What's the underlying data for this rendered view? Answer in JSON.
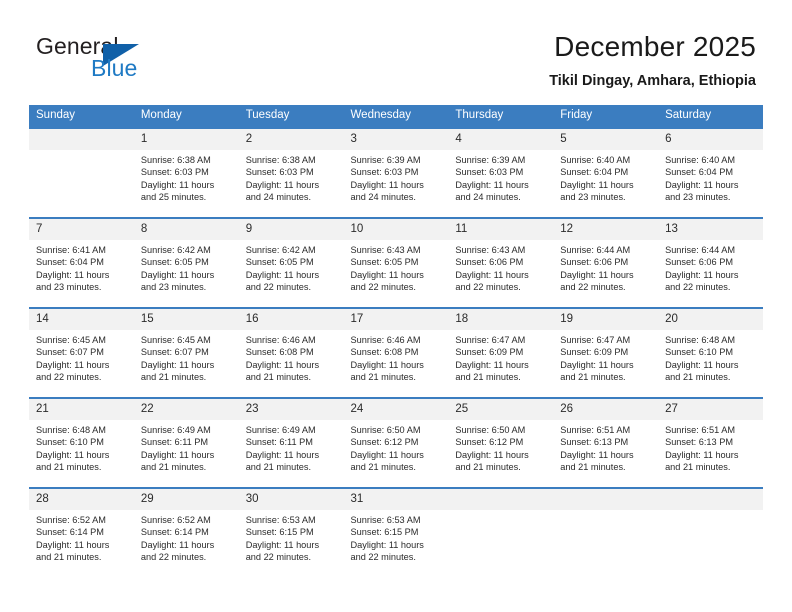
{
  "brand": {
    "name_part1": "General",
    "name_part2": "Blue",
    "accent_color": "#1060a8",
    "blue_text_color": "#1f7ac4"
  },
  "header": {
    "title": "December 2025",
    "subtitle": "Tikil Dingay, Amhara, Ethiopia"
  },
  "calendar": {
    "header_bg": "#3b7dc0",
    "datenum_bg": "#f2f2f2",
    "weekday_headers": [
      "Sunday",
      "Monday",
      "Tuesday",
      "Wednesday",
      "Thursday",
      "Friday",
      "Saturday"
    ],
    "labels": {
      "sunrise": "Sunrise:",
      "sunset": "Sunset:",
      "daylight": "Daylight:"
    },
    "weeks": [
      [
        {
          "day": "",
          "sunrise": "",
          "sunset": "",
          "daylight_line1": "",
          "daylight_line2": ""
        },
        {
          "day": "1",
          "sunrise": "Sunrise: 6:38 AM",
          "sunset": "Sunset: 6:03 PM",
          "daylight_line1": "Daylight: 11 hours",
          "daylight_line2": "and 25 minutes."
        },
        {
          "day": "2",
          "sunrise": "Sunrise: 6:38 AM",
          "sunset": "Sunset: 6:03 PM",
          "daylight_line1": "Daylight: 11 hours",
          "daylight_line2": "and 24 minutes."
        },
        {
          "day": "3",
          "sunrise": "Sunrise: 6:39 AM",
          "sunset": "Sunset: 6:03 PM",
          "daylight_line1": "Daylight: 11 hours",
          "daylight_line2": "and 24 minutes."
        },
        {
          "day": "4",
          "sunrise": "Sunrise: 6:39 AM",
          "sunset": "Sunset: 6:03 PM",
          "daylight_line1": "Daylight: 11 hours",
          "daylight_line2": "and 24 minutes."
        },
        {
          "day": "5",
          "sunrise": "Sunrise: 6:40 AM",
          "sunset": "Sunset: 6:04 PM",
          "daylight_line1": "Daylight: 11 hours",
          "daylight_line2": "and 23 minutes."
        },
        {
          "day": "6",
          "sunrise": "Sunrise: 6:40 AM",
          "sunset": "Sunset: 6:04 PM",
          "daylight_line1": "Daylight: 11 hours",
          "daylight_line2": "and 23 minutes."
        }
      ],
      [
        {
          "day": "7",
          "sunrise": "Sunrise: 6:41 AM",
          "sunset": "Sunset: 6:04 PM",
          "daylight_line1": "Daylight: 11 hours",
          "daylight_line2": "and 23 minutes."
        },
        {
          "day": "8",
          "sunrise": "Sunrise: 6:42 AM",
          "sunset": "Sunset: 6:05 PM",
          "daylight_line1": "Daylight: 11 hours",
          "daylight_line2": "and 23 minutes."
        },
        {
          "day": "9",
          "sunrise": "Sunrise: 6:42 AM",
          "sunset": "Sunset: 6:05 PM",
          "daylight_line1": "Daylight: 11 hours",
          "daylight_line2": "and 22 minutes."
        },
        {
          "day": "10",
          "sunrise": "Sunrise: 6:43 AM",
          "sunset": "Sunset: 6:05 PM",
          "daylight_line1": "Daylight: 11 hours",
          "daylight_line2": "and 22 minutes."
        },
        {
          "day": "11",
          "sunrise": "Sunrise: 6:43 AM",
          "sunset": "Sunset: 6:06 PM",
          "daylight_line1": "Daylight: 11 hours",
          "daylight_line2": "and 22 minutes."
        },
        {
          "day": "12",
          "sunrise": "Sunrise: 6:44 AM",
          "sunset": "Sunset: 6:06 PM",
          "daylight_line1": "Daylight: 11 hours",
          "daylight_line2": "and 22 minutes."
        },
        {
          "day": "13",
          "sunrise": "Sunrise: 6:44 AM",
          "sunset": "Sunset: 6:06 PM",
          "daylight_line1": "Daylight: 11 hours",
          "daylight_line2": "and 22 minutes."
        }
      ],
      [
        {
          "day": "14",
          "sunrise": "Sunrise: 6:45 AM",
          "sunset": "Sunset: 6:07 PM",
          "daylight_line1": "Daylight: 11 hours",
          "daylight_line2": "and 22 minutes."
        },
        {
          "day": "15",
          "sunrise": "Sunrise: 6:45 AM",
          "sunset": "Sunset: 6:07 PM",
          "daylight_line1": "Daylight: 11 hours",
          "daylight_line2": "and 21 minutes."
        },
        {
          "day": "16",
          "sunrise": "Sunrise: 6:46 AM",
          "sunset": "Sunset: 6:08 PM",
          "daylight_line1": "Daylight: 11 hours",
          "daylight_line2": "and 21 minutes."
        },
        {
          "day": "17",
          "sunrise": "Sunrise: 6:46 AM",
          "sunset": "Sunset: 6:08 PM",
          "daylight_line1": "Daylight: 11 hours",
          "daylight_line2": "and 21 minutes."
        },
        {
          "day": "18",
          "sunrise": "Sunrise: 6:47 AM",
          "sunset": "Sunset: 6:09 PM",
          "daylight_line1": "Daylight: 11 hours",
          "daylight_line2": "and 21 minutes."
        },
        {
          "day": "19",
          "sunrise": "Sunrise: 6:47 AM",
          "sunset": "Sunset: 6:09 PM",
          "daylight_line1": "Daylight: 11 hours",
          "daylight_line2": "and 21 minutes."
        },
        {
          "day": "20",
          "sunrise": "Sunrise: 6:48 AM",
          "sunset": "Sunset: 6:10 PM",
          "daylight_line1": "Daylight: 11 hours",
          "daylight_line2": "and 21 minutes."
        }
      ],
      [
        {
          "day": "21",
          "sunrise": "Sunrise: 6:48 AM",
          "sunset": "Sunset: 6:10 PM",
          "daylight_line1": "Daylight: 11 hours",
          "daylight_line2": "and 21 minutes."
        },
        {
          "day": "22",
          "sunrise": "Sunrise: 6:49 AM",
          "sunset": "Sunset: 6:11 PM",
          "daylight_line1": "Daylight: 11 hours",
          "daylight_line2": "and 21 minutes."
        },
        {
          "day": "23",
          "sunrise": "Sunrise: 6:49 AM",
          "sunset": "Sunset: 6:11 PM",
          "daylight_line1": "Daylight: 11 hours",
          "daylight_line2": "and 21 minutes."
        },
        {
          "day": "24",
          "sunrise": "Sunrise: 6:50 AM",
          "sunset": "Sunset: 6:12 PM",
          "daylight_line1": "Daylight: 11 hours",
          "daylight_line2": "and 21 minutes."
        },
        {
          "day": "25",
          "sunrise": "Sunrise: 6:50 AM",
          "sunset": "Sunset: 6:12 PM",
          "daylight_line1": "Daylight: 11 hours",
          "daylight_line2": "and 21 minutes."
        },
        {
          "day": "26",
          "sunrise": "Sunrise: 6:51 AM",
          "sunset": "Sunset: 6:13 PM",
          "daylight_line1": "Daylight: 11 hours",
          "daylight_line2": "and 21 minutes."
        },
        {
          "day": "27",
          "sunrise": "Sunrise: 6:51 AM",
          "sunset": "Sunset: 6:13 PM",
          "daylight_line1": "Daylight: 11 hours",
          "daylight_line2": "and 21 minutes."
        }
      ],
      [
        {
          "day": "28",
          "sunrise": "Sunrise: 6:52 AM",
          "sunset": "Sunset: 6:14 PM",
          "daylight_line1": "Daylight: 11 hours",
          "daylight_line2": "and 21 minutes."
        },
        {
          "day": "29",
          "sunrise": "Sunrise: 6:52 AM",
          "sunset": "Sunset: 6:14 PM",
          "daylight_line1": "Daylight: 11 hours",
          "daylight_line2": "and 22 minutes."
        },
        {
          "day": "30",
          "sunrise": "Sunrise: 6:53 AM",
          "sunset": "Sunset: 6:15 PM",
          "daylight_line1": "Daylight: 11 hours",
          "daylight_line2": "and 22 minutes."
        },
        {
          "day": "31",
          "sunrise": "Sunrise: 6:53 AM",
          "sunset": "Sunset: 6:15 PM",
          "daylight_line1": "Daylight: 11 hours",
          "daylight_line2": "and 22 minutes."
        },
        {
          "day": "",
          "sunrise": "",
          "sunset": "",
          "daylight_line1": "",
          "daylight_line2": ""
        },
        {
          "day": "",
          "sunrise": "",
          "sunset": "",
          "daylight_line1": "",
          "daylight_line2": ""
        },
        {
          "day": "",
          "sunrise": "",
          "sunset": "",
          "daylight_line1": "",
          "daylight_line2": ""
        }
      ]
    ]
  }
}
